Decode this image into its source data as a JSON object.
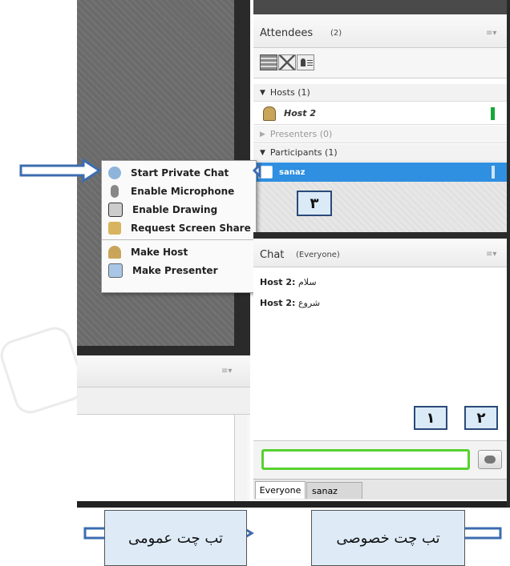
{
  "attendees": {
    "title": "Attendees",
    "count": "(2)",
    "menu": "≡▾",
    "groups": {
      "hosts": "Hosts (1)",
      "presenters": "Presenters (0)",
      "participants": "Participants (1)"
    },
    "host_name": "Host 2",
    "participant_name": "sanaz"
  },
  "context_menu": {
    "items": [
      "Start Private Chat",
      "Enable Microphone",
      "Enable Drawing",
      "Request Screen Share",
      "Make Host",
      "Make Presenter"
    ]
  },
  "chat": {
    "title": "Chat",
    "scope": "(Everyone)",
    "menu": "≡▾",
    "messages": [
      {
        "sender": "Host 2:",
        "text": "سلام"
      },
      {
        "sender": "Host 2:",
        "text": "شروع"
      }
    ],
    "input_value": "",
    "tabs": [
      "Everyone",
      "sanaz"
    ]
  },
  "other_pod": {
    "menu": "≡▾"
  },
  "annotations": {
    "num1": "۱",
    "num2": "۲",
    "num3": "۳",
    "public_tab_label": "تب چت عمومی",
    "private_tab_label": "تب چت خصوصی"
  },
  "colors": {
    "selected_row": "#2f8fe0",
    "input_border": "#58d130",
    "status_green": "#16a83a",
    "arrow_blue": "#3c6cb0"
  }
}
